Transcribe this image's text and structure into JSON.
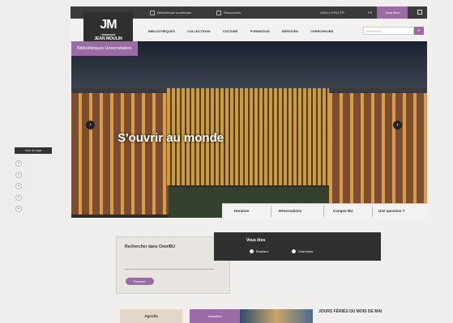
{
  "topbar": {
    "link1": "Bibliothèque numérique",
    "link2": "Ressources",
    "access": "UNIV-LYON3.FR",
    "lang": "FR",
    "vous_etes": "Vous êtes"
  },
  "logo": {
    "line1": "UNIVERSITÉ",
    "line2": "JEAN MOULIN"
  },
  "menu": [
    "BIBLIOTHÈQUES",
    "COLLECTIONS",
    "CULTURE",
    "FORMATION",
    "SERVICES",
    "CHERCHEURS"
  ],
  "search": {
    "placeholder": "Rechercher..."
  },
  "hero": {
    "tag": "Bibliothèques Universitaires",
    "title": "S'ouvrir au monde"
  },
  "quick": [
    "Horaires",
    "Réservations",
    "Compte BU",
    "Une question ?"
  ],
  "side": {
    "tab": "Haut de page"
  },
  "omnibu": {
    "title": "Rechercher dans OmniBU",
    "button": "Envoyer"
  },
  "vous": {
    "title": "Vous êtes",
    "option1": "Étudiant",
    "option2": "Chercheur"
  },
  "bottom": {
    "agenda": "Agenda",
    "actu": "Actualités",
    "jours": "JOURS FÉRIÉS DU MOIS DE MAI"
  }
}
